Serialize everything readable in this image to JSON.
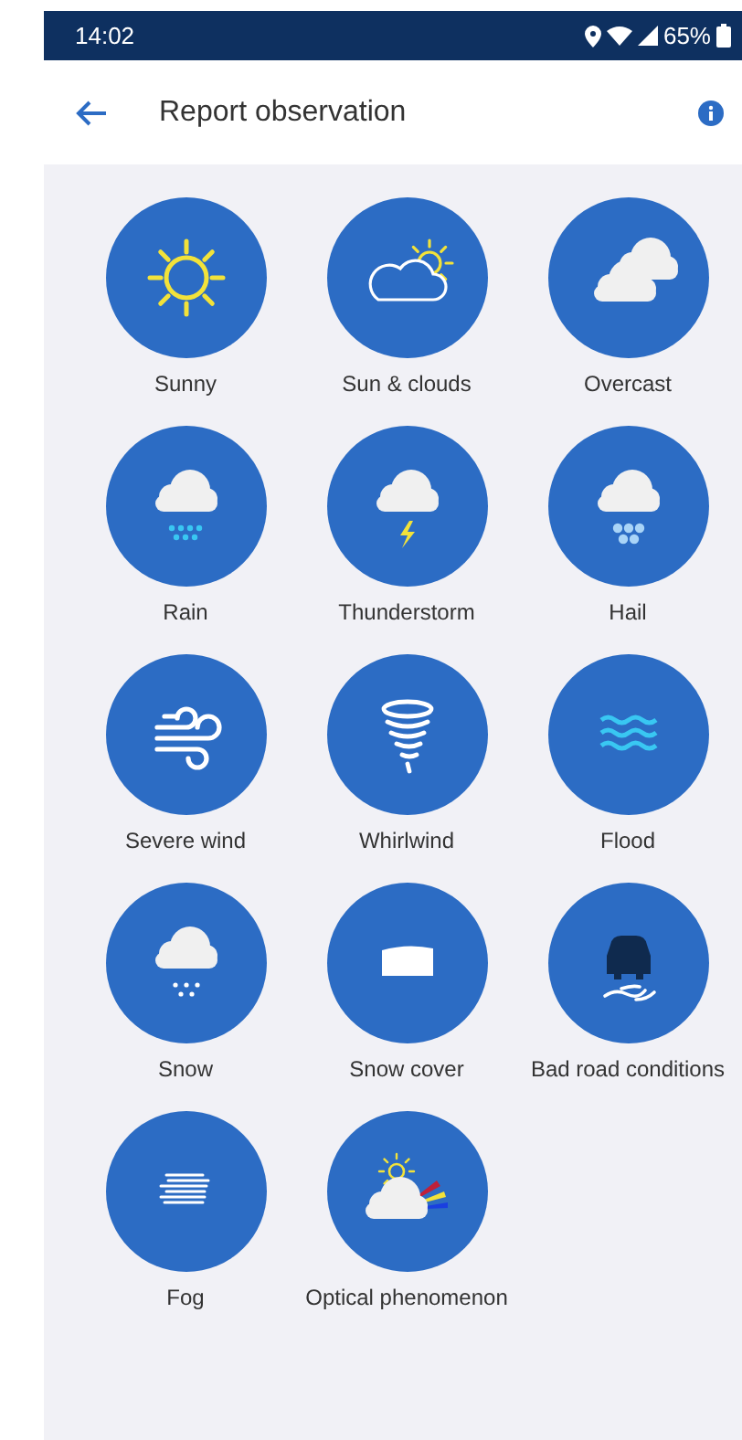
{
  "status_bar": {
    "time": "14:02",
    "battery": "65%"
  },
  "header": {
    "title": "Report observation"
  },
  "options": [
    {
      "label": "Sunny",
      "kind": "sunny"
    },
    {
      "label": "Sun & clouds",
      "kind": "sun_clouds"
    },
    {
      "label": "Overcast",
      "kind": "overcast"
    },
    {
      "label": "Rain",
      "kind": "rain"
    },
    {
      "label": "Thunderstorm",
      "kind": "thunderstorm"
    },
    {
      "label": "Hail",
      "kind": "hail"
    },
    {
      "label": "Severe wind",
      "kind": "wind"
    },
    {
      "label": "Whirlwind",
      "kind": "whirlwind"
    },
    {
      "label": "Flood",
      "kind": "flood"
    },
    {
      "label": "Snow",
      "kind": "snow"
    },
    {
      "label": "Snow cover",
      "kind": "snow_cover"
    },
    {
      "label": "Bad road conditions",
      "kind": "road"
    },
    {
      "label": "Fog",
      "kind": "fog"
    },
    {
      "label": "Optical phenomenon",
      "kind": "optical"
    }
  ]
}
